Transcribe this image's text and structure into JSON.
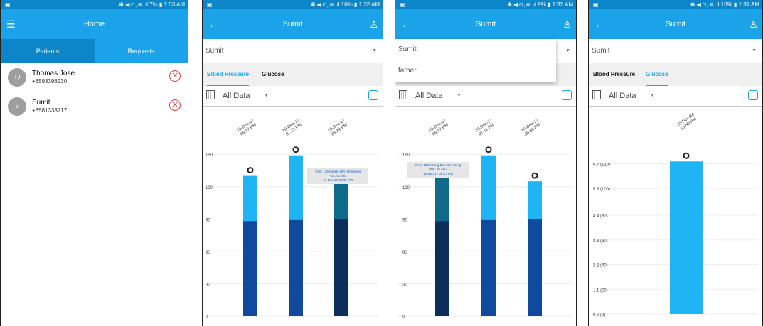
{
  "screens": [
    {
      "status": {
        "left": "▣",
        "right": "✱ ◀ ◘ ᷊ ᪤ .ıl 7% ▮ 1:33 AM"
      },
      "title": "Home",
      "tabs": [
        "Patients",
        "Requests"
      ],
      "contacts": [
        {
          "initials": "TJ",
          "name": "Thomas Jose",
          "phone": "+6593396230"
        },
        {
          "initials": "S",
          "name": "Sumit",
          "phone": "+6581338717"
        }
      ]
    },
    {
      "status": {
        "left": "▣",
        "right": "✱ ◀ ◘ ᷊ ᪤ .ıl 10% ▮ 1:32 AM"
      },
      "title": "Sumit",
      "select": "Sumit",
      "subtabs": [
        "Blood Pressure",
        "Glucose"
      ],
      "filter": "All Data",
      "tooltip": [
        "SYS: 125 mmHg DIA: 90 mmHg",
        "PUL: 91 min.",
        "10-Dec-17 08:39 PM"
      ]
    },
    {
      "status": {
        "left": "▣",
        "right": "✱ ◀ ◘ ᷊ ᪤ .ıl 9% ▮ 1:32 AM"
      },
      "title": "Sumit",
      "select": "Sumit",
      "dropdown": [
        "Sumit",
        "father"
      ],
      "filter": "All Data",
      "tooltip": [
        "SYS: 130 mmHg DIA: 88 mmHg",
        "PUL: 91 min.",
        "10-Dec-17 06:47 PM"
      ]
    },
    {
      "status": {
        "left": "▣",
        "right": "✱ ◀ ◘ ᷊ ᪤ .ıl 10% ▮ 1:31 AM"
      },
      "title": "Sumit",
      "select": "Sumit",
      "subtabs": [
        "Blood Pressure",
        "Glucose"
      ],
      "filter": "All Data"
    }
  ],
  "icons": {
    "menu": "hamburger-icon",
    "back": "back-arrow-icon",
    "profile": "person-icon",
    "remove": "remove-circle-icon",
    "calendar": "calendar-icon",
    "chart": "chart-icon"
  },
  "colors": {
    "appbar": "#1aa3e8",
    "statusbar": "#0d86c9",
    "sys_bar": "#1fb5f5",
    "dia_bar": "#0f4a9c",
    "dia_dark": "#0b2e5c",
    "highlight": "#0f6a8c",
    "glucose_bar": "#1fb5f5"
  },
  "chart_data": [
    {
      "type": "bar",
      "categories": [
        "10-Dec-17\n06:47 PM",
        "10-Dec-17\n07:11 PM",
        "10-Dec-17\n08:39 PM"
      ],
      "series": [
        {
          "name": "SYS",
          "values": [
            130,
            149,
            125
          ]
        },
        {
          "name": "DIA",
          "values": [
            88,
            89,
            90
          ]
        }
      ],
      "yticks": [
        0,
        30,
        60,
        90,
        120,
        150
      ],
      "ylim": [
        0,
        160
      ],
      "selected_index": 2
    },
    {
      "type": "bar",
      "categories": [
        "10-Dec-17\n06:47 PM",
        "10-Dec-17\n07:11 PM",
        "10-Dec-17\n08:39 PM"
      ],
      "series": [
        {
          "name": "SYS",
          "values": [
            130,
            149,
            125
          ]
        },
        {
          "name": "DIA",
          "values": [
            88,
            89,
            90
          ]
        }
      ],
      "yticks": [
        0,
        30,
        60,
        90,
        120,
        150
      ],
      "ylim": [
        0,
        160
      ],
      "selected_index": 0
    },
    {
      "type": "bar",
      "categories": [
        "20-Nov-24\n10:50 PM"
      ],
      "series": [
        {
          "name": "Glucose",
          "values": [
            6.8
          ]
        }
      ],
      "yticks": [
        0,
        1.1,
        2.2,
        3.3,
        4.4,
        5.6,
        6.7
      ],
      "yticklabels": [
        "0.0 (0)",
        "1.1 (20)",
        "2.2 (40)",
        "3.3 (60)",
        "4.4 (80)",
        "5.6 (100)",
        "6.7 (120)"
      ],
      "ylim": [
        0,
        7.6
      ]
    }
  ]
}
